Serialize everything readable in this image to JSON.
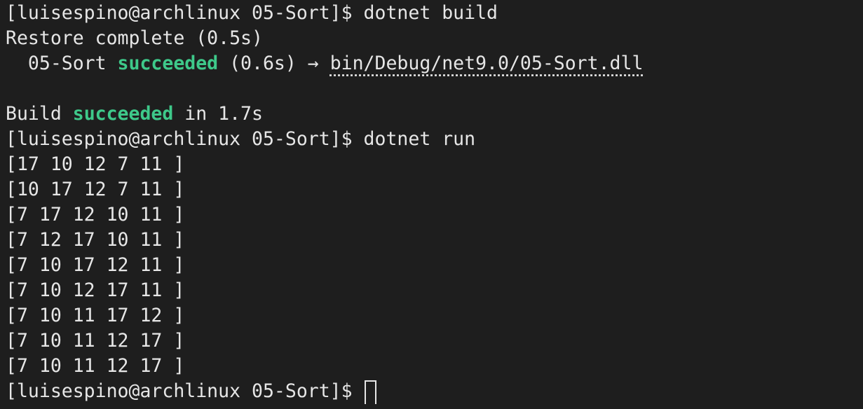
{
  "prompt": "[luisespino@archlinux 05-Sort]$ ",
  "commands": {
    "build": "dotnet build",
    "run": "dotnet run"
  },
  "build_output": {
    "restore": "Restore complete (0.5s)",
    "project_prefix": "  05-Sort ",
    "succeeded_word": "succeeded",
    "project_time": " (0.6s) → ",
    "output_path": "bin/Debug/net9.0/05-Sort.dll",
    "summary_prefix": "Build ",
    "summary_suffix": " in 1.7s"
  },
  "run_output": [
    "[17 10 12 7 11 ]",
    "[10 17 12 7 11 ]",
    "[7 17 12 10 11 ]",
    "[7 12 17 10 11 ]",
    "[7 10 17 12 11 ]",
    "[7 10 12 17 11 ]",
    "[7 10 11 17 12 ]",
    "[7 10 11 12 17 ]",
    "[7 10 11 12 17 ]"
  ],
  "colors": {
    "background": "#1e1e1e",
    "foreground": "#e6e6e6",
    "success": "#3ec98a"
  }
}
